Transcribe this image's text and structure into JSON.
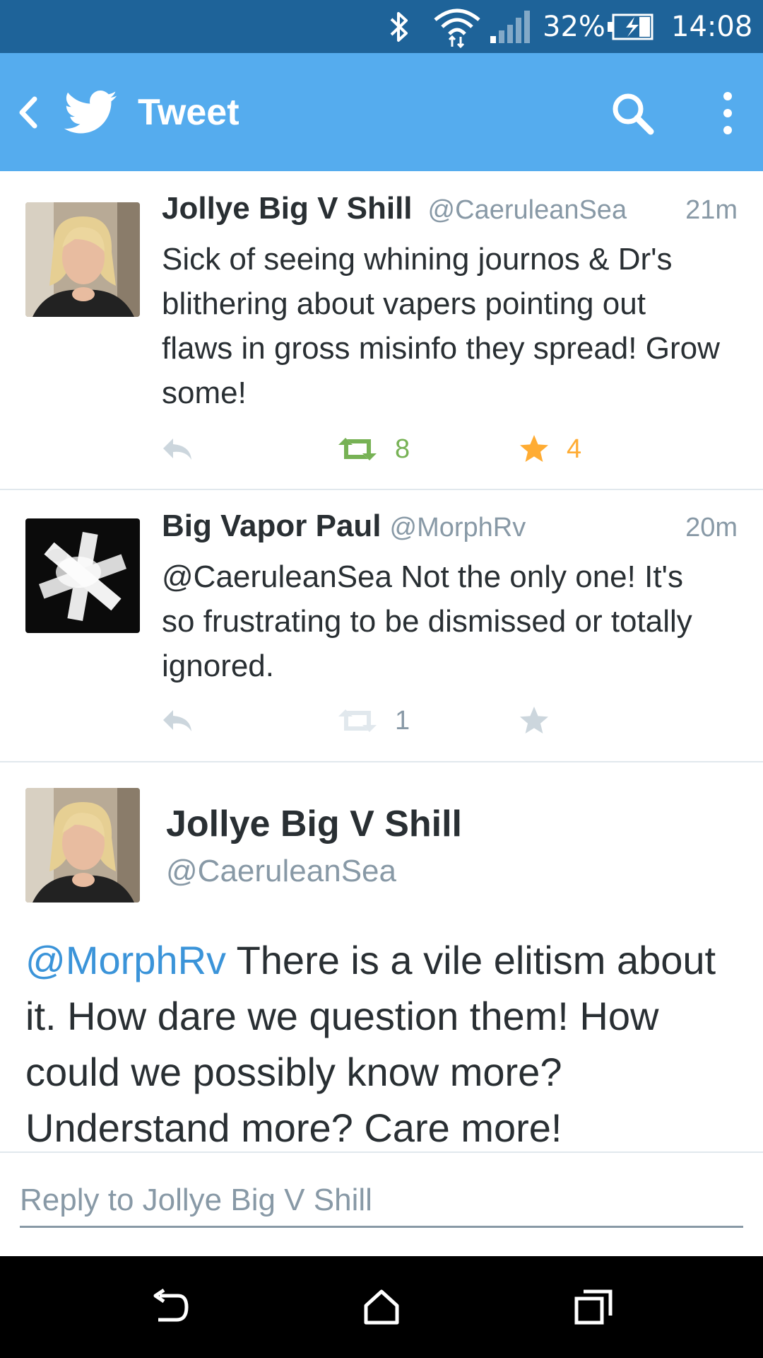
{
  "status_bar": {
    "battery": "32%",
    "time": "14:08",
    "icons": [
      "bluetooth-icon",
      "wifi-icon",
      "signal-icon",
      "battery-charging-icon"
    ]
  },
  "app_bar": {
    "title": "Tweet",
    "icons": [
      "back-icon",
      "twitter-bird-icon",
      "search-icon",
      "overflow-menu-icon"
    ],
    "background": "#55acee"
  },
  "timeline": [
    {
      "name": "Jollye Big V Shill",
      "handle": "@CaeruleanSea",
      "time": "21m",
      "text": "Sick of seeing whining journos & Dr's blithering about vapers pointing out flaws in gross misinfo they spread! Grow some!",
      "retweets": "8",
      "favorites": "4",
      "retweeted": true,
      "favorited": true
    },
    {
      "name": "Big Vapor Paul",
      "handle": "@MorphRv",
      "time": "20m",
      "text": "@CaeruleanSea Not the only one! It's so frustrating to be dismissed or totally ignored.",
      "retweets": "1",
      "favorites": "",
      "retweeted": false,
      "favorited": false
    }
  ],
  "detail": {
    "name": "Jollye Big V Shill",
    "handle": "@CaeruleanSea",
    "mention": "@MorphRv",
    "text": " There is a vile elitism about it. How dare we question them! How could we possibly know more? Understand more? Care more!"
  },
  "reply": {
    "placeholder": "Reply to Jollye Big V Shill"
  },
  "colors": {
    "retweet_active": "#77b255",
    "favorite_active": "#ffac33",
    "action_inactive": "#ccd6dd",
    "mention": "#3b94d9"
  }
}
